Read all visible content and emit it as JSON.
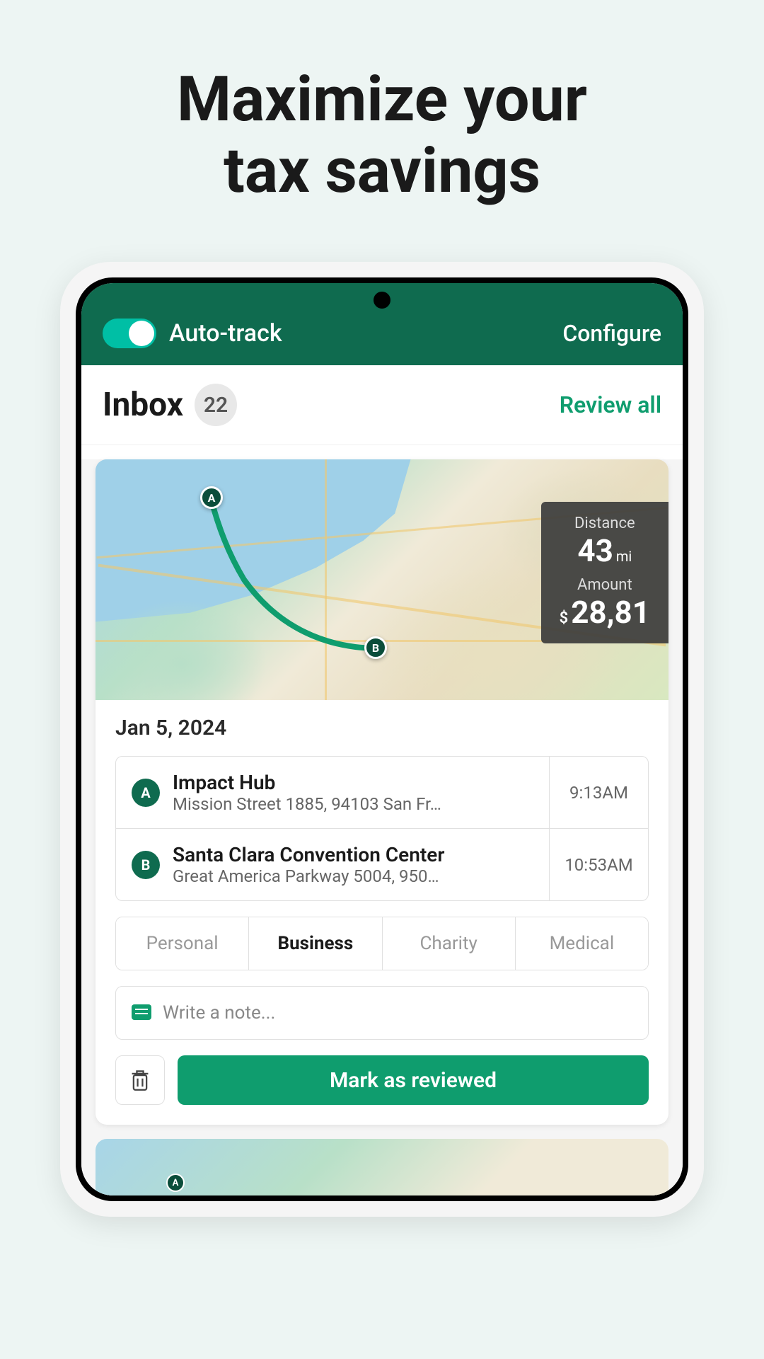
{
  "promo": {
    "title_line1": "Maximize your",
    "title_line2": "tax savings"
  },
  "header": {
    "auto_track_label": "Auto-track",
    "configure_label": "Configure"
  },
  "inbox": {
    "title": "Inbox",
    "count": "22",
    "review_all_label": "Review all"
  },
  "trip": {
    "distance_label": "Distance",
    "distance_value": "43",
    "distance_unit": "mi",
    "amount_label": "Amount",
    "amount_currency": "$",
    "amount_value": "28,81",
    "date": "Jan 5, 2024",
    "start": {
      "marker": "A",
      "name": "Impact Hub",
      "address": "Mission Street 1885, 94103 San Fr…",
      "time": "9:13AM"
    },
    "end": {
      "marker": "B",
      "name": "Santa Clara Convention Center",
      "address": "Great America Parkway 5004, 950…",
      "time": "10:53AM"
    }
  },
  "categories": {
    "personal": "Personal",
    "business": "Business",
    "charity": "Charity",
    "medical": "Medical"
  },
  "note": {
    "placeholder": "Write a note..."
  },
  "actions": {
    "mark_reviewed": "Mark as reviewed"
  },
  "peek": {
    "marker": "A"
  }
}
